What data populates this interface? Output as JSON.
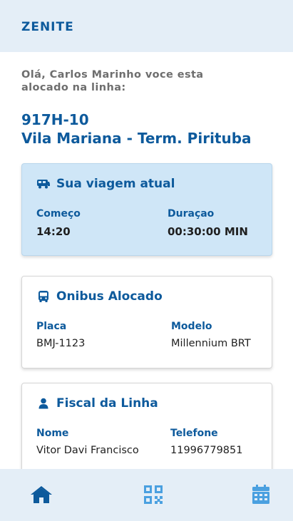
{
  "app": {
    "brand": "ZENITE"
  },
  "greeting": "Olá, Carlos Marinho voce esta alocado na linha:",
  "line": {
    "code": "917H-10",
    "name": "Vila Mariana - Term. Pirituba"
  },
  "current_trip": {
    "title": "Sua viagem atual",
    "icon": "bus-icon",
    "start_label": "Começo",
    "start_value": "14:20",
    "duration_label": "Duraçao",
    "duration_value": "00:30:00 MIN"
  },
  "bus": {
    "title": "Onibus Alocado",
    "icon": "bus-front-icon",
    "plate_label": "Placa",
    "plate_value": "BMJ-1123",
    "model_label": "Modelo",
    "model_value": "Millennium BRT"
  },
  "inspector": {
    "title": "Fiscal da Linha",
    "icon": "user-icon",
    "name_label": "Nome",
    "name_value": "Vitor Davi Francisco",
    "phone_label": "Telefone",
    "phone_value": "11996779851"
  },
  "bottom_nav": {
    "items": [
      {
        "name": "home",
        "icon": "home-icon",
        "color": "#0d5a9c"
      },
      {
        "name": "qr-code",
        "icon": "qr-code-icon",
        "color": "#4aa0e0"
      },
      {
        "name": "calendar",
        "icon": "calendar-icon",
        "color": "#4aa0e0"
      }
    ]
  },
  "colors": {
    "primary": "#0d5a9c",
    "accent": "#4aa0e0",
    "bar_bg": "#e4eef7",
    "current_card_bg": "#cfe6f7"
  }
}
